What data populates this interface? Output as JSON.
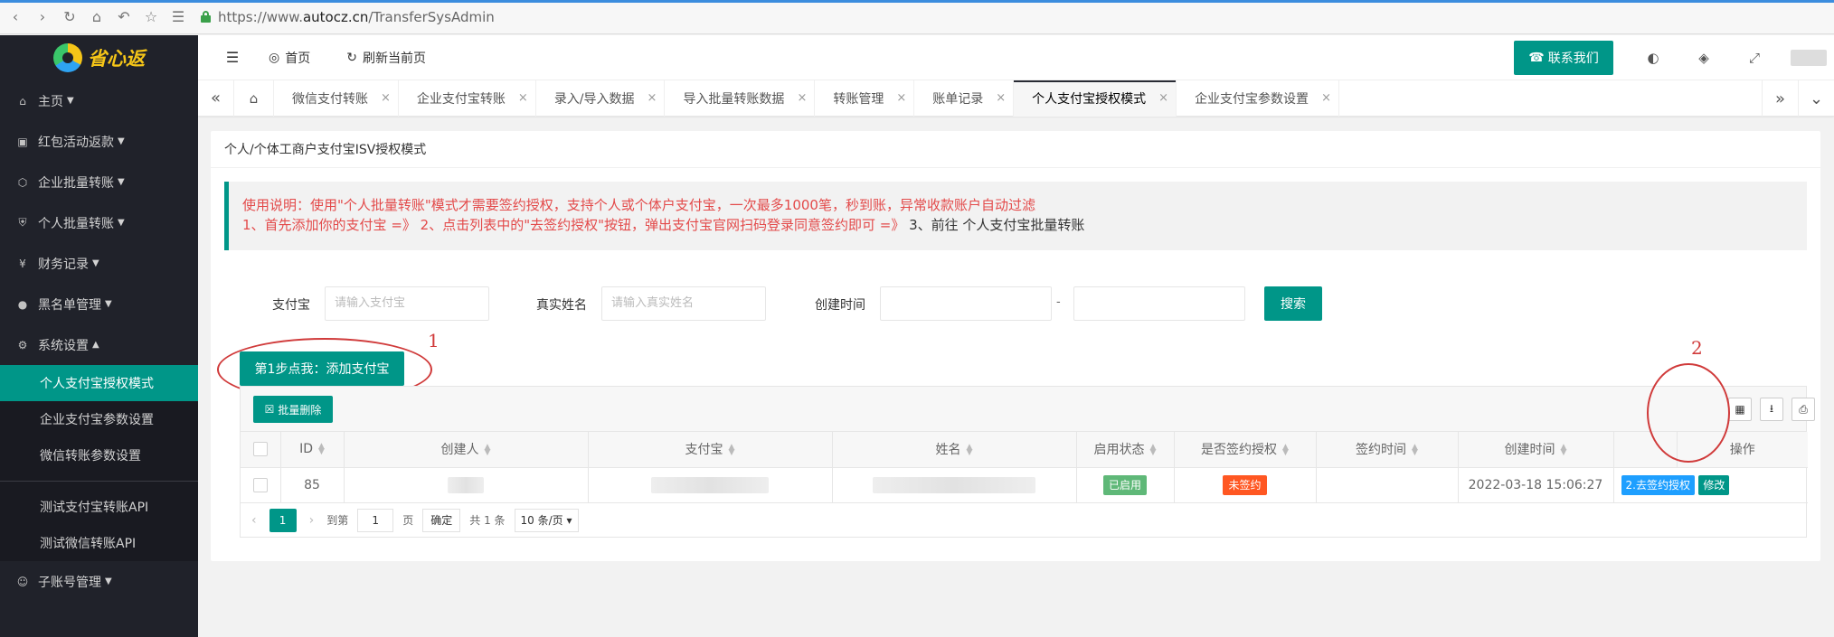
{
  "browser": {
    "url_prefix": "https://www.",
    "url_domain": "autocz.cn",
    "url_path": "/TransferSysAdmin"
  },
  "sidebar": {
    "logo_text": "省心返",
    "menu": [
      {
        "label": "主页",
        "icon": "home-icon"
      },
      {
        "label": "红包活动返款",
        "icon": "gift-icon"
      },
      {
        "label": "企业批量转账",
        "icon": "cube-icon"
      },
      {
        "label": "个人批量转账",
        "icon": "shield-icon"
      },
      {
        "label": "财务记录",
        "icon": "yen-icon"
      },
      {
        "label": "黑名单管理",
        "icon": "user-icon"
      },
      {
        "label": "系统设置",
        "icon": "gear-icon"
      }
    ],
    "sub_menu": [
      {
        "label": "个人支付宝授权模式"
      },
      {
        "label": "企业支付宝参数设置"
      },
      {
        "label": "微信转账参数设置"
      },
      {
        "label": "测试支付宝转账API"
      },
      {
        "label": "测试微信转账API"
      }
    ],
    "bottom_menu": {
      "label": "子账号管理",
      "icon": "user-group-icon"
    }
  },
  "topbar": {
    "home_label": "首页",
    "refresh_label": "刷新当前页",
    "contact_label": "联系我们"
  },
  "tabs": [
    {
      "label": "微信支付转账"
    },
    {
      "label": "企业支付宝转账"
    },
    {
      "label": "录入/导入数据"
    },
    {
      "label": "导入批量转账数据"
    },
    {
      "label": "转账管理"
    },
    {
      "label": "账单记录"
    },
    {
      "label": "个人支付宝授权模式"
    },
    {
      "label": "企业支付宝参数设置"
    }
  ],
  "page": {
    "title": "个人/个体工商户支付宝ISV授权模式",
    "notice_line1": "使用说明：使用\"个人批量转账\"模式才需要签约授权，支持个人或个体户支付宝，一次最多1000笔，秒到账，异常收款账户自动过滤",
    "notice_line2_red": "1、首先添加你的支付宝 =》 2、点击列表中的\"去签约授权\"按钮，弹出支付宝官网扫码登录同意签约即可 =》",
    "notice_line2_dark": " 3、前往 个人支付宝批量转账"
  },
  "search": {
    "alipay_label": "支付宝",
    "alipay_placeholder": "请输入支付宝",
    "realname_label": "真实姓名",
    "realname_placeholder": "请输入真实姓名",
    "created_label": "创建时间",
    "range_sep": "-",
    "search_button": "搜索"
  },
  "actions": {
    "add_button": "第1步点我：添加支付宝",
    "batch_delete": "批量删除",
    "annotation_1": "1",
    "annotation_2": "2"
  },
  "table": {
    "headers": [
      "ID",
      "创建人",
      "支付宝",
      "姓名",
      "启用状态",
      "是否签约授权",
      "签约时间",
      "创建时间",
      "操作"
    ],
    "row": {
      "id": "85",
      "enabled": "已启用",
      "signed": "未签约",
      "sign_time": "",
      "created": "2022-03-18 15:06:27",
      "auth_button": "2.去签约授权",
      "edit_button": "修改"
    }
  },
  "pager": {
    "current_page": "1",
    "goto_label": "到第",
    "goto_value": "1",
    "page_unit": "页",
    "confirm": "确定",
    "total": "共 1 条",
    "page_size": "10 条/页"
  }
}
